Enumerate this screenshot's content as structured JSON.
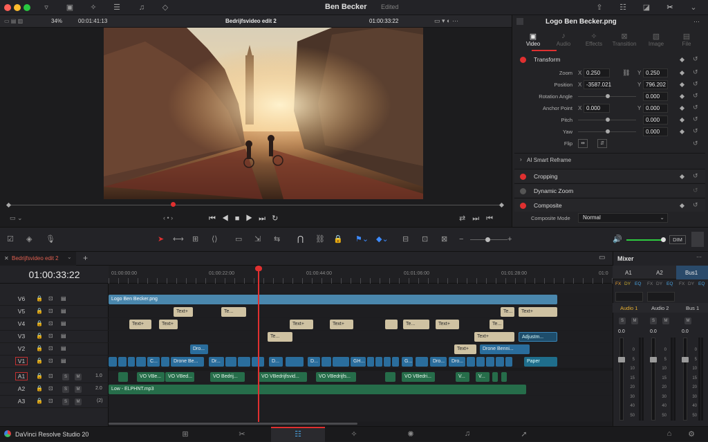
{
  "titlebar": {
    "project_name": "Ben Becker",
    "status": "Edited"
  },
  "viewer_bar": {
    "zoom": "34%",
    "source_timecode": "00:01:41:13",
    "timeline_name": "Bedrijfsvideo edit 2",
    "record_timecode": "01:00:33:22"
  },
  "inspector": {
    "clip_name": "Logo Ben Becker.png",
    "tabs": [
      {
        "label": "Video"
      },
      {
        "label": "Audio"
      },
      {
        "label": "Effects"
      },
      {
        "label": "Transition"
      },
      {
        "label": "Image"
      },
      {
        "label": "File"
      }
    ],
    "transform": {
      "label": "Transform",
      "zoom_label": "Zoom",
      "zoom_x": "0.250",
      "zoom_y": "0.250",
      "position_label": "Position",
      "position_x": "-3587.021",
      "position_y": "796.202",
      "rotation_label": "Rotation Angle",
      "rotation": "0.000",
      "anchor_label": "Anchor Point",
      "anchor_x": "0.000",
      "anchor_y": "0.000",
      "pitch_label": "Pitch",
      "pitch": "0.000",
      "yaw_label": "Yaw",
      "yaw": "0.000",
      "flip_label": "Flip",
      "x": "X",
      "y": "Y"
    },
    "smart_reframe": "AI Smart Reframe",
    "cropping": "Cropping",
    "dynamic_zoom": "Dynamic Zoom",
    "composite": "Composite",
    "composite_mode_label": "Composite Mode",
    "composite_mode": "Normal"
  },
  "timeline": {
    "tab_name": "Bedrijfsvideo edit 2",
    "timecode": "01:00:33:22",
    "ruler": [
      "01:00:00:00",
      "01:00:22:00",
      "01:00:44:00",
      "01:01:06:00",
      "01:01:28:00",
      "01:0"
    ],
    "tracks": [
      {
        "name": "V6"
      },
      {
        "name": "V5"
      },
      {
        "name": "V4"
      },
      {
        "name": "V3"
      },
      {
        "name": "V2"
      },
      {
        "name": "V1"
      },
      {
        "name": "A1",
        "level": "1.0"
      },
      {
        "name": "A2",
        "level": "2.0"
      },
      {
        "name": "A3",
        "level": "(2)"
      }
    ],
    "clips": {
      "logo": "Logo Ben Becker.png",
      "text": "Text+",
      "te": "Te...",
      "adjust": "Adjustm...",
      "drone": "Dro...",
      "drone_benni": "Drone Benni...",
      "paper": "Paper",
      "v1_c": "C...",
      "v1_drone_be": "Drone Be...",
      "v1_dr": "Dr...",
      "v1_d": "D...",
      "v1_gh": "GH...",
      "v1_g": "G...",
      "v1_dro": "Dro...",
      "v1_dro2": "Dro...",
      "a1_1": "VO VBe...",
      "a1_2": "VO VBed...",
      "a1_3": "VO Bedrij...",
      "a1_4": "VO VBedrijfsvid...",
      "a1_5": "VO VBedrijfs...",
      "a1_6": "VO VBedri...",
      "a1_7": "V...",
      "a1_8": "V...",
      "a2": "Low - ELPHNT.mp3"
    }
  },
  "mixer": {
    "title": "Mixer",
    "channels": [
      {
        "name": "A1",
        "track": "Audio 1"
      },
      {
        "name": "A2",
        "track": "Audio 2"
      },
      {
        "name": "Bus1",
        "track": "Bus 1"
      }
    ],
    "fx": "FX",
    "dy": "DY",
    "eq": "EQ",
    "level": "0.0",
    "s": "S",
    "m": "M",
    "scale": [
      "0",
      "5",
      "10",
      "15",
      "20",
      "30",
      "40",
      "50"
    ]
  },
  "toolbar": {
    "dim": "DIM"
  },
  "footer": {
    "app_name": "DaVinci Resolve Studio 20"
  },
  "colors": {
    "accent": "#e03030",
    "text_clip": "#cfc2a2",
    "video_clip": "#2a6d9c",
    "audio_clip": "#266d4a"
  }
}
